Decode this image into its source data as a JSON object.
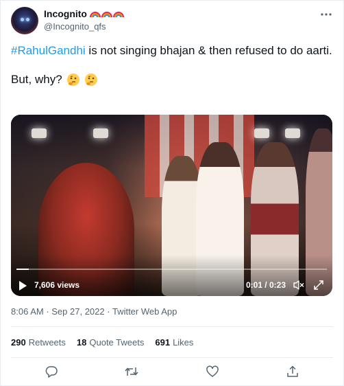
{
  "author": {
    "display_name": "Incognito",
    "handle": "@Incognito_qfs",
    "emoji_icons": [
      "rainbow-icon",
      "rainbow-icon",
      "rainbow-icon"
    ]
  },
  "tweet": {
    "hashtag": "#RahulGandhi",
    "text_rest": " is not singing bhajan & then refused to do aarti.",
    "para2": "But, why?",
    "para2_emoji": [
      "thinking-face-icon",
      "thinking-face-icon"
    ]
  },
  "video": {
    "views": "7,606 views",
    "time": "0:01 / 0:23",
    "progress": 0.04
  },
  "meta": {
    "time": "8:06 AM",
    "sep1": " · ",
    "date": "Sep 27, 2022",
    "sep2": " · ",
    "source": "Twitter Web App"
  },
  "stats": {
    "retweets_count": "290",
    "retweets_label": "Retweets",
    "quotes_count": "18",
    "quotes_label": "Quote Tweets",
    "likes_count": "691",
    "likes_label": "Likes"
  },
  "actions": [
    "reply-icon",
    "retweet-icon",
    "like-icon",
    "share-icon"
  ],
  "colors": {
    "accent": "#1d9bf0",
    "secondary_text": "#536471",
    "primary_text": "#0f1419"
  }
}
